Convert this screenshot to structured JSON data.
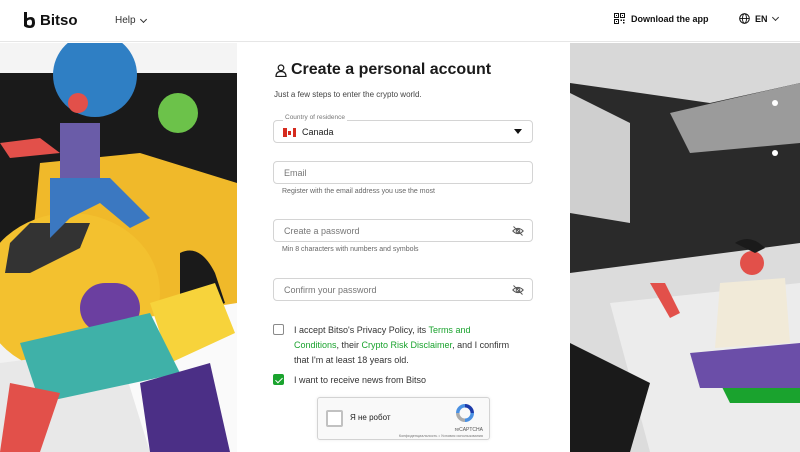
{
  "header": {
    "brand": "Bitso",
    "help_label": "Help",
    "download_label": "Download the app",
    "language_label": "EN"
  },
  "form": {
    "title": "Create a personal account",
    "subtitle": "Just a few steps to enter the crypto world.",
    "country": {
      "label": "Country of residence",
      "value": "Canada"
    },
    "email": {
      "placeholder": "Email",
      "hint": "Register with the email address you use the most"
    },
    "password": {
      "placeholder": "Create a password",
      "hint": "Min 8 characters with numbers and symbols"
    },
    "confirm_password": {
      "placeholder": "Confirm your password"
    },
    "terms": {
      "checked": false,
      "text_1": "I accept Bitso's Privacy Policy, its ",
      "link_1": "Terms and Conditions",
      "text_2": ", their ",
      "link_2": "Crypto Risk Disclaimer",
      "text_3": ", and I confirm that I'm at least 18 years old."
    },
    "news": {
      "checked": true,
      "label": "I want to receive news from Bitso"
    },
    "captcha": {
      "label": "Я не робот",
      "brand": "reCAPTCHA",
      "terms": "Конфиденциальность • Условия использования"
    }
  },
  "colors": {
    "accent_green": "#1aa32e",
    "text_dark": "#1a1a1a"
  }
}
